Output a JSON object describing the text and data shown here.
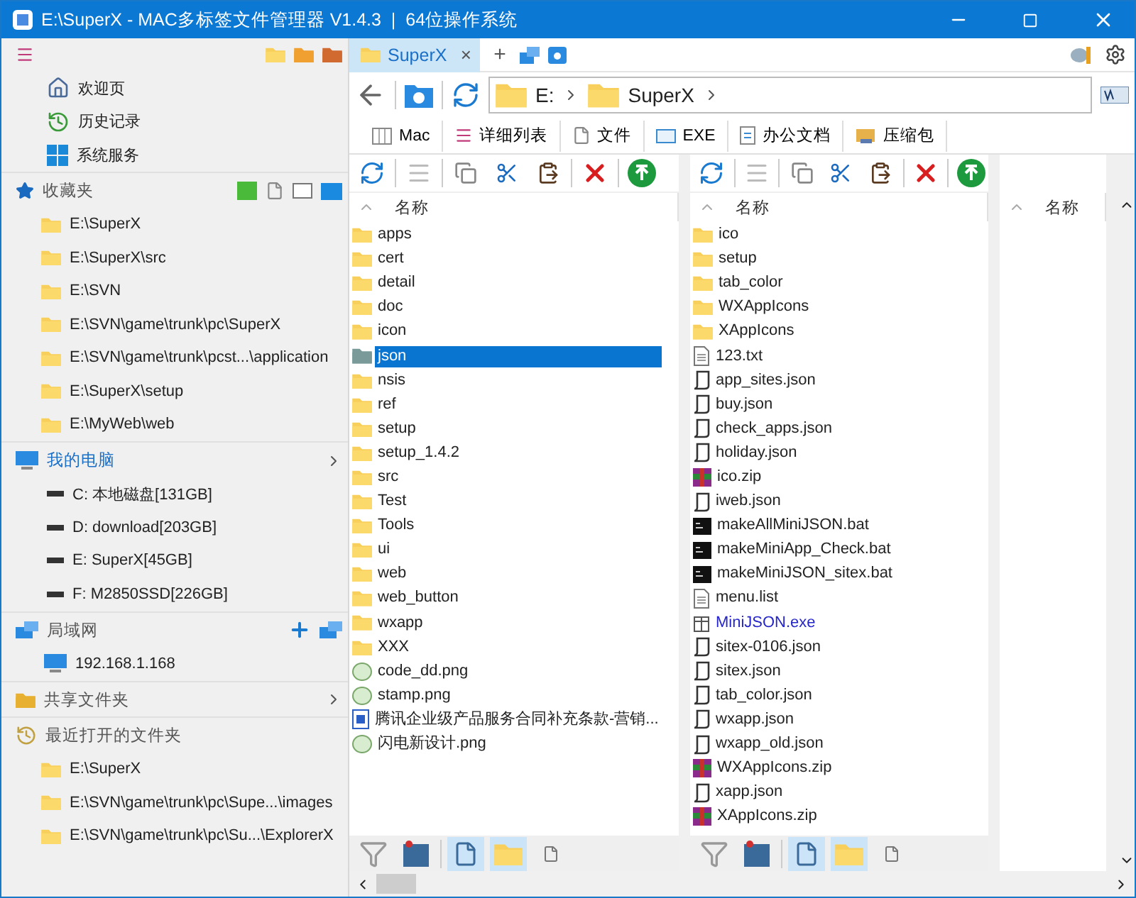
{
  "window": {
    "title": "E:\\SuperX - MAC多标签文件管理器 V1.4.3  |  64位操作系统"
  },
  "sidebar": {
    "top_items": [
      {
        "label": "欢迎页",
        "kind": "home"
      },
      {
        "label": "历史记录",
        "kind": "history"
      },
      {
        "label": "系统服务",
        "kind": "windows"
      }
    ],
    "favorites": {
      "title": "收藏夹",
      "items": [
        "E:\\SuperX",
        "E:\\SuperX\\src",
        "E:\\SVN",
        "E:\\SVN\\game\\trunk\\pc\\SuperX",
        "E:\\SVN\\game\\trunk\\pcst...\\application",
        "E:\\SuperX\\setup",
        "E:\\MyWeb\\web"
      ]
    },
    "computer": {
      "title": "我的电脑",
      "drives": [
        "C: 本地磁盘[131GB]",
        "D: download[203GB]",
        "E: SuperX[45GB]",
        "F: M2850SSD[226GB]"
      ]
    },
    "lan": {
      "title": "局域网",
      "hosts": [
        "192.168.1.168"
      ]
    },
    "shared": {
      "title": "共享文件夹"
    },
    "recent": {
      "title": "最近打开的文件夹",
      "items": [
        "E:\\SuperX",
        "E:\\SVN\\game\\trunk\\pc\\Supe...\\images",
        "E:\\SVN\\game\\trunk\\pc\\Su...\\ExplorerX"
      ]
    }
  },
  "tabs": [
    {
      "label": "SuperX",
      "selected": true,
      "close": "×"
    }
  ],
  "new_tab": "+",
  "address": {
    "crumbs": [
      "E:",
      "SuperX"
    ]
  },
  "quick_filters": [
    {
      "label": "Mac",
      "kind": "mac"
    },
    {
      "label": "详细列表",
      "kind": "list"
    },
    {
      "label": "文件",
      "kind": "file"
    },
    {
      "label": "EXE",
      "kind": "exe"
    },
    {
      "label": "办公文档",
      "kind": "doc"
    },
    {
      "label": "压缩包",
      "kind": "zip"
    }
  ],
  "panes": [
    {
      "column": "名称",
      "files": [
        {
          "name": "apps",
          "kind": "folder",
          "selected": false
        },
        {
          "name": "cert",
          "kind": "folder",
          "selected": false
        },
        {
          "name": "detail",
          "kind": "folder",
          "selected": false
        },
        {
          "name": "doc",
          "kind": "folder",
          "selected": false
        },
        {
          "name": "icon",
          "kind": "folder",
          "selected": false
        },
        {
          "name": "json",
          "kind": "folder",
          "selected": true
        },
        {
          "name": "nsis",
          "kind": "folder",
          "selected": false
        },
        {
          "name": "ref",
          "kind": "folder",
          "selected": false
        },
        {
          "name": "setup",
          "kind": "folder",
          "selected": false
        },
        {
          "name": "setup_1.4.2",
          "kind": "folder",
          "selected": false
        },
        {
          "name": "src",
          "kind": "folder",
          "selected": false
        },
        {
          "name": "Test",
          "kind": "folder",
          "selected": false
        },
        {
          "name": "Tools",
          "kind": "folder",
          "selected": false
        },
        {
          "name": "ui",
          "kind": "folder",
          "selected": false
        },
        {
          "name": "web",
          "kind": "folder",
          "selected": false
        },
        {
          "name": "web_button",
          "kind": "folder",
          "selected": false
        },
        {
          "name": "wxapp",
          "kind": "folder",
          "selected": false
        },
        {
          "name": "XXX",
          "kind": "folder",
          "selected": false
        },
        {
          "name": "code_dd.png",
          "kind": "png",
          "selected": false
        },
        {
          "name": "stamp.png",
          "kind": "png",
          "selected": false
        },
        {
          "name": "腾讯企业级产品服务合同补充条款-营销...",
          "kind": "doc",
          "selected": false
        },
        {
          "name": "闪电新设计.png",
          "kind": "png",
          "selected": false
        }
      ],
      "view_buttons": [
        {
          "selected": true
        },
        {
          "selected": true
        },
        {
          "selected": false
        }
      ]
    },
    {
      "column": "名称",
      "files": [
        {
          "name": "ico",
          "kind": "folder",
          "selected": false
        },
        {
          "name": "setup",
          "kind": "folder",
          "selected": false
        },
        {
          "name": "tab_color",
          "kind": "folder",
          "selected": false
        },
        {
          "name": "WXAppIcons",
          "kind": "folder",
          "selected": false
        },
        {
          "name": "XAppIcons",
          "kind": "folder",
          "selected": false
        },
        {
          "name": "123.txt",
          "kind": "txt",
          "selected": false
        },
        {
          "name": "app_sites.json",
          "kind": "json",
          "selected": false
        },
        {
          "name": "buy.json",
          "kind": "json",
          "selected": false
        },
        {
          "name": "check_apps.json",
          "kind": "json",
          "selected": false
        },
        {
          "name": "holiday.json",
          "kind": "json",
          "selected": false
        },
        {
          "name": "ico.zip",
          "kind": "zip",
          "selected": false
        },
        {
          "name": "iweb.json",
          "kind": "json",
          "selected": false
        },
        {
          "name": "makeAllMiniJSON.bat",
          "kind": "bat",
          "selected": false
        },
        {
          "name": "makeMiniApp_Check.bat",
          "kind": "bat",
          "selected": false
        },
        {
          "name": "makeMiniJSON_sitex.bat",
          "kind": "bat",
          "selected": false
        },
        {
          "name": "menu.list",
          "kind": "txt",
          "selected": false
        },
        {
          "name": "MiniJSON.exe",
          "kind": "exe",
          "selected": false
        },
        {
          "name": "sitex-0106.json",
          "kind": "json",
          "selected": false
        },
        {
          "name": "sitex.json",
          "kind": "json",
          "selected": false
        },
        {
          "name": "tab_color.json",
          "kind": "json",
          "selected": false
        },
        {
          "name": "wxapp.json",
          "kind": "json",
          "selected": false
        },
        {
          "name": "wxapp_old.json",
          "kind": "json",
          "selected": false
        },
        {
          "name": "WXAppIcons.zip",
          "kind": "zip",
          "selected": false
        },
        {
          "name": "xapp.json",
          "kind": "json",
          "selected": false
        },
        {
          "name": "XAppIcons.zip",
          "kind": "zip",
          "selected": false
        }
      ],
      "view_buttons": [
        {
          "selected": true
        },
        {
          "selected": true
        },
        {
          "selected": false
        }
      ]
    },
    {
      "column": "名称"
    }
  ]
}
